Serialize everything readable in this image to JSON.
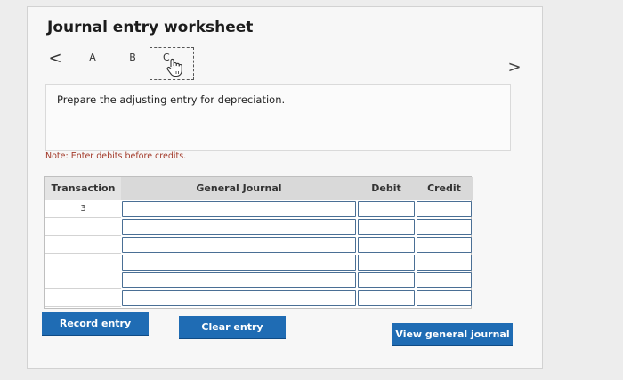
{
  "worksheet": {
    "title": "Journal entry worksheet",
    "nav_prev": "<",
    "nav_next": ">",
    "tabs": [
      {
        "label": "A"
      },
      {
        "label": "B"
      },
      {
        "label": "C"
      }
    ],
    "instruction": "Prepare the adjusting entry for depreciation.",
    "note": "Note: Enter debits before credits."
  },
  "journal": {
    "headers": {
      "transaction": "Transaction",
      "general_journal": "General Journal",
      "debit": "Debit",
      "credit": "Credit"
    },
    "rows": [
      {
        "transaction": "3",
        "general_journal": "",
        "debit": "",
        "credit": ""
      },
      {
        "transaction": "",
        "general_journal": "",
        "debit": "",
        "credit": ""
      },
      {
        "transaction": "",
        "general_journal": "",
        "debit": "",
        "credit": ""
      },
      {
        "transaction": "",
        "general_journal": "",
        "debit": "",
        "credit": ""
      },
      {
        "transaction": "",
        "general_journal": "",
        "debit": "",
        "credit": ""
      },
      {
        "transaction": "",
        "general_journal": "",
        "debit": "",
        "credit": ""
      }
    ]
  },
  "buttons": {
    "record": "Record entry",
    "clear": "Clear entry",
    "view": "View general journal"
  },
  "colors": {
    "button": "#1f6cb4",
    "note": "#a33a2a",
    "input_border": "#4a6f95"
  },
  "icons": {
    "active_tab_cursor": "hand-pointer-icon"
  }
}
